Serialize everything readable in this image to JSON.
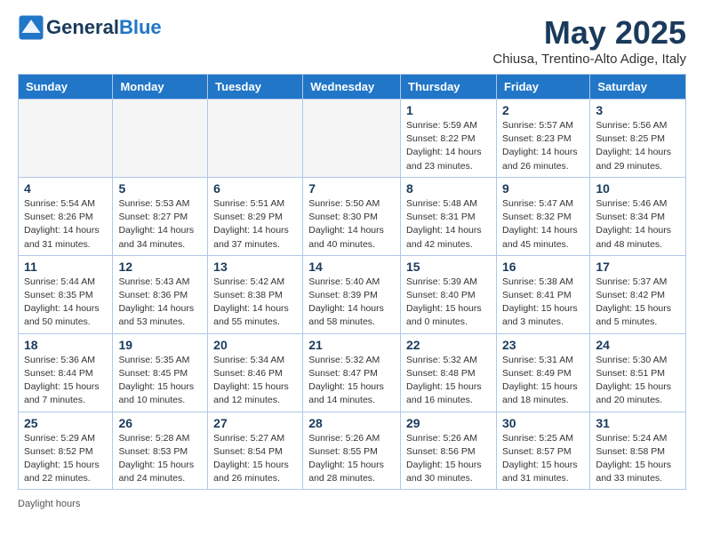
{
  "header": {
    "logo_line1": "General",
    "logo_line2": "Blue",
    "month_title": "May 2025",
    "subtitle": "Chiusa, Trentino-Alto Adige, Italy"
  },
  "footer": {
    "note": "Daylight hours"
  },
  "days_of_week": [
    "Sunday",
    "Monday",
    "Tuesday",
    "Wednesday",
    "Thursday",
    "Friday",
    "Saturday"
  ],
  "weeks": [
    [
      {
        "num": "",
        "info": ""
      },
      {
        "num": "",
        "info": ""
      },
      {
        "num": "",
        "info": ""
      },
      {
        "num": "",
        "info": ""
      },
      {
        "num": "1",
        "info": "Sunrise: 5:59 AM\nSunset: 8:22 PM\nDaylight: 14 hours and 23 minutes."
      },
      {
        "num": "2",
        "info": "Sunrise: 5:57 AM\nSunset: 8:23 PM\nDaylight: 14 hours and 26 minutes."
      },
      {
        "num": "3",
        "info": "Sunrise: 5:56 AM\nSunset: 8:25 PM\nDaylight: 14 hours and 29 minutes."
      }
    ],
    [
      {
        "num": "4",
        "info": "Sunrise: 5:54 AM\nSunset: 8:26 PM\nDaylight: 14 hours and 31 minutes."
      },
      {
        "num": "5",
        "info": "Sunrise: 5:53 AM\nSunset: 8:27 PM\nDaylight: 14 hours and 34 minutes."
      },
      {
        "num": "6",
        "info": "Sunrise: 5:51 AM\nSunset: 8:29 PM\nDaylight: 14 hours and 37 minutes."
      },
      {
        "num": "7",
        "info": "Sunrise: 5:50 AM\nSunset: 8:30 PM\nDaylight: 14 hours and 40 minutes."
      },
      {
        "num": "8",
        "info": "Sunrise: 5:48 AM\nSunset: 8:31 PM\nDaylight: 14 hours and 42 minutes."
      },
      {
        "num": "9",
        "info": "Sunrise: 5:47 AM\nSunset: 8:32 PM\nDaylight: 14 hours and 45 minutes."
      },
      {
        "num": "10",
        "info": "Sunrise: 5:46 AM\nSunset: 8:34 PM\nDaylight: 14 hours and 48 minutes."
      }
    ],
    [
      {
        "num": "11",
        "info": "Sunrise: 5:44 AM\nSunset: 8:35 PM\nDaylight: 14 hours and 50 minutes."
      },
      {
        "num": "12",
        "info": "Sunrise: 5:43 AM\nSunset: 8:36 PM\nDaylight: 14 hours and 53 minutes."
      },
      {
        "num": "13",
        "info": "Sunrise: 5:42 AM\nSunset: 8:38 PM\nDaylight: 14 hours and 55 minutes."
      },
      {
        "num": "14",
        "info": "Sunrise: 5:40 AM\nSunset: 8:39 PM\nDaylight: 14 hours and 58 minutes."
      },
      {
        "num": "15",
        "info": "Sunrise: 5:39 AM\nSunset: 8:40 PM\nDaylight: 15 hours and 0 minutes."
      },
      {
        "num": "16",
        "info": "Sunrise: 5:38 AM\nSunset: 8:41 PM\nDaylight: 15 hours and 3 minutes."
      },
      {
        "num": "17",
        "info": "Sunrise: 5:37 AM\nSunset: 8:42 PM\nDaylight: 15 hours and 5 minutes."
      }
    ],
    [
      {
        "num": "18",
        "info": "Sunrise: 5:36 AM\nSunset: 8:44 PM\nDaylight: 15 hours and 7 minutes."
      },
      {
        "num": "19",
        "info": "Sunrise: 5:35 AM\nSunset: 8:45 PM\nDaylight: 15 hours and 10 minutes."
      },
      {
        "num": "20",
        "info": "Sunrise: 5:34 AM\nSunset: 8:46 PM\nDaylight: 15 hours and 12 minutes."
      },
      {
        "num": "21",
        "info": "Sunrise: 5:32 AM\nSunset: 8:47 PM\nDaylight: 15 hours and 14 minutes."
      },
      {
        "num": "22",
        "info": "Sunrise: 5:32 AM\nSunset: 8:48 PM\nDaylight: 15 hours and 16 minutes."
      },
      {
        "num": "23",
        "info": "Sunrise: 5:31 AM\nSunset: 8:49 PM\nDaylight: 15 hours and 18 minutes."
      },
      {
        "num": "24",
        "info": "Sunrise: 5:30 AM\nSunset: 8:51 PM\nDaylight: 15 hours and 20 minutes."
      }
    ],
    [
      {
        "num": "25",
        "info": "Sunrise: 5:29 AM\nSunset: 8:52 PM\nDaylight: 15 hours and 22 minutes."
      },
      {
        "num": "26",
        "info": "Sunrise: 5:28 AM\nSunset: 8:53 PM\nDaylight: 15 hours and 24 minutes."
      },
      {
        "num": "27",
        "info": "Sunrise: 5:27 AM\nSunset: 8:54 PM\nDaylight: 15 hours and 26 minutes."
      },
      {
        "num": "28",
        "info": "Sunrise: 5:26 AM\nSunset: 8:55 PM\nDaylight: 15 hours and 28 minutes."
      },
      {
        "num": "29",
        "info": "Sunrise: 5:26 AM\nSunset: 8:56 PM\nDaylight: 15 hours and 30 minutes."
      },
      {
        "num": "30",
        "info": "Sunrise: 5:25 AM\nSunset: 8:57 PM\nDaylight: 15 hours and 31 minutes."
      },
      {
        "num": "31",
        "info": "Sunrise: 5:24 AM\nSunset: 8:58 PM\nDaylight: 15 hours and 33 minutes."
      }
    ]
  ]
}
